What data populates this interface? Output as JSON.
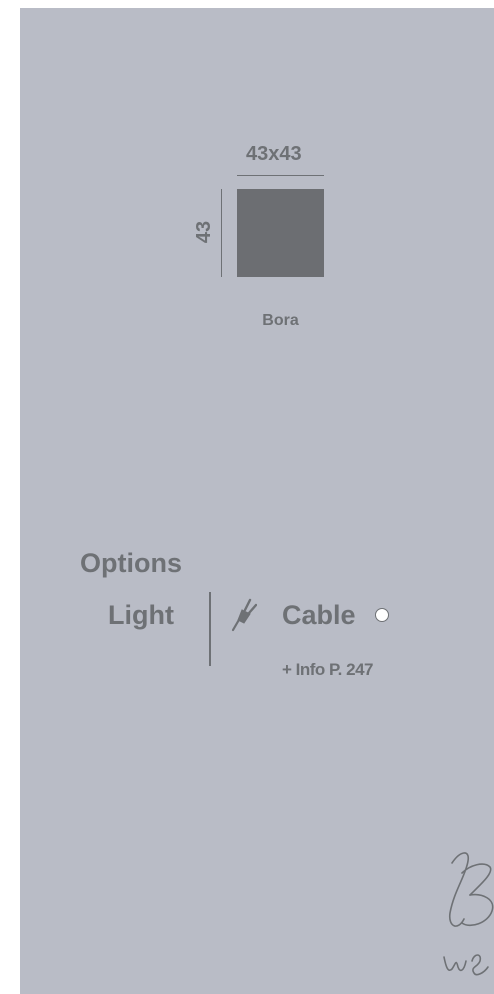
{
  "product": {
    "dimensions_top": "43x43",
    "dimensions_side": "43",
    "name": "Bora",
    "swatch_color": "#6c6e72"
  },
  "options": {
    "title": "Options",
    "label": "Light",
    "icon": "plug-icon",
    "value": "Cable",
    "info_ref": "+ Info P. 247"
  },
  "colors": {
    "background": "#b9bcc6",
    "text": "#6e7175"
  }
}
